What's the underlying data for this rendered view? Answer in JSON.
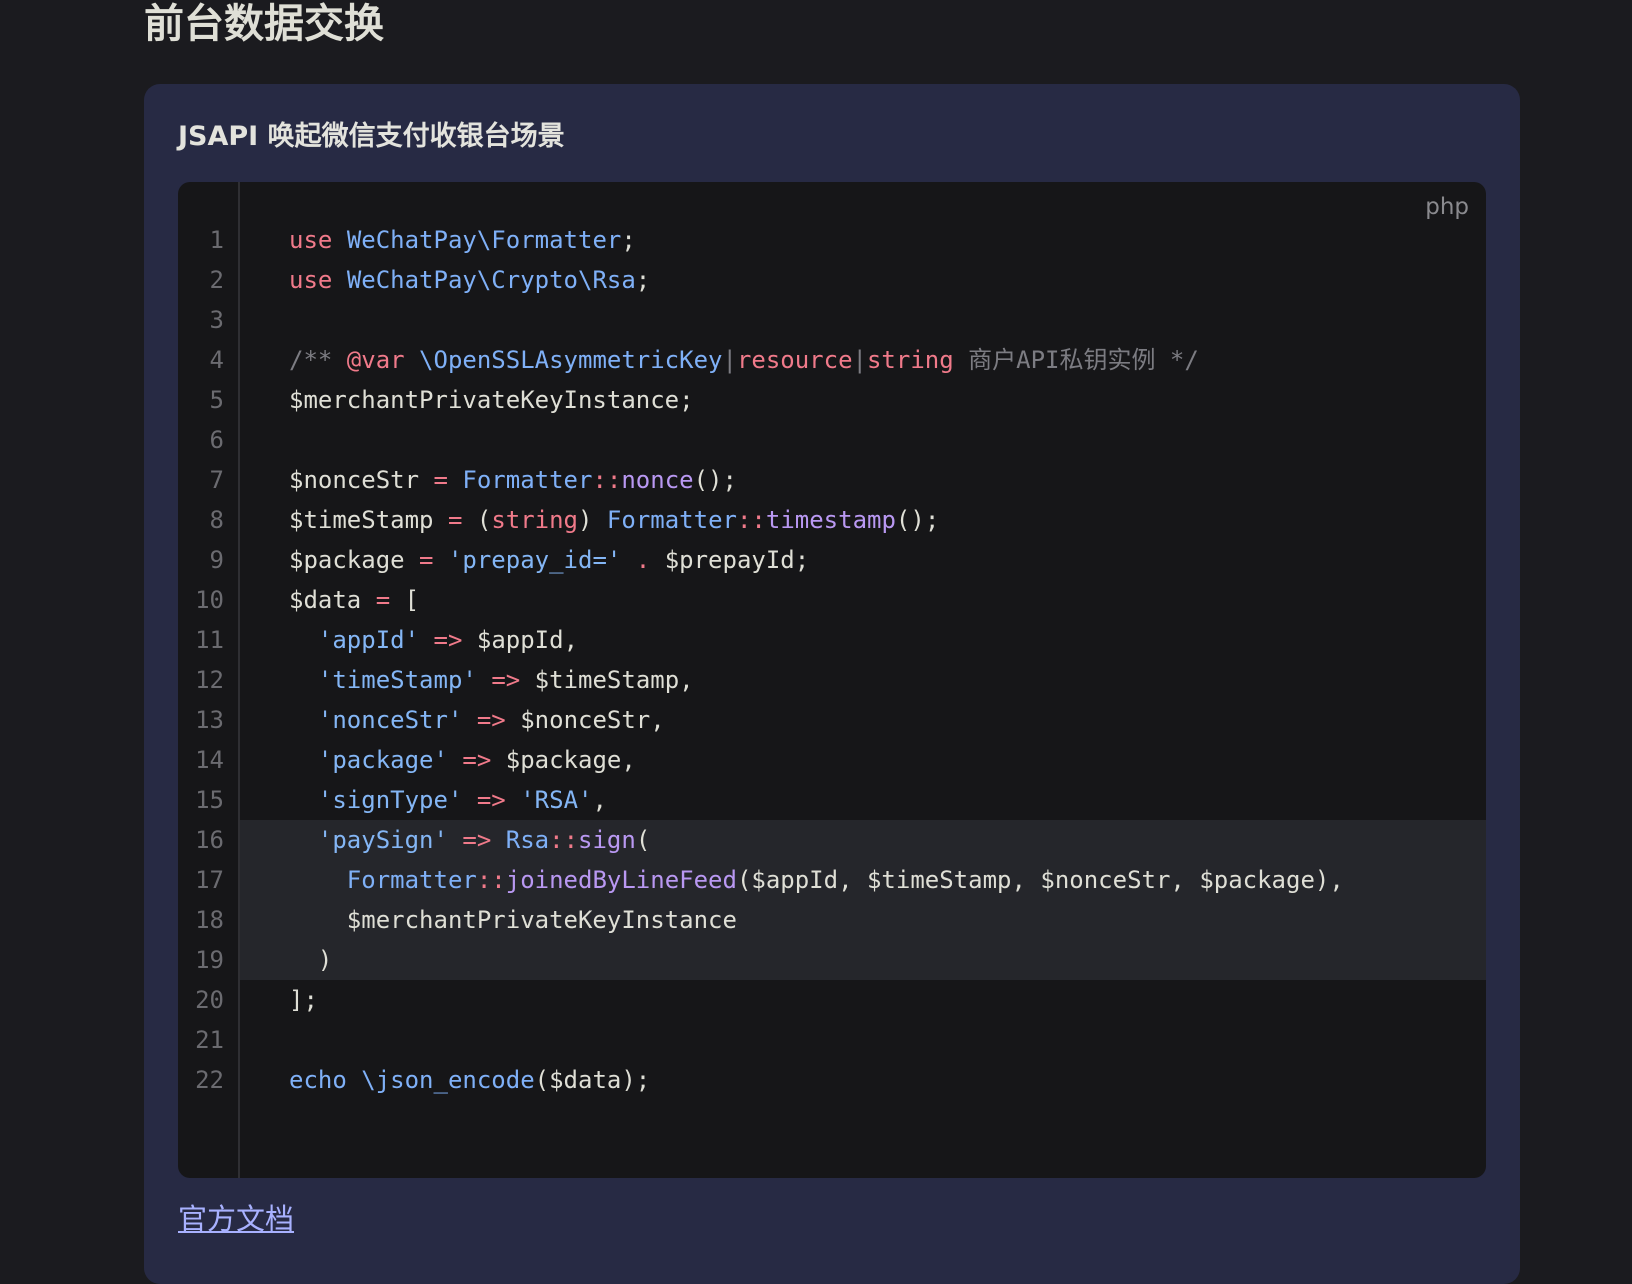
{
  "page": {
    "title": "前台数据交换"
  },
  "card": {
    "title": "JSAPI 唤起微信支付收银台场景",
    "lang_label": "php",
    "doc_link": "官方文档"
  },
  "code": {
    "highlighted_lines": [
      16,
      17,
      18,
      19
    ],
    "lines": [
      [
        [
          "kw",
          "use"
        ],
        [
          "t",
          " "
        ],
        [
          "ns",
          "WeChatPay\\Formatter"
        ],
        [
          "t",
          ";"
        ]
      ],
      [
        [
          "kw",
          "use"
        ],
        [
          "t",
          " "
        ],
        [
          "ns",
          "WeChatPay\\Crypto\\Rsa"
        ],
        [
          "t",
          ";"
        ]
      ],
      [],
      [
        [
          "cm",
          "/** "
        ],
        [
          "tag",
          "@var"
        ],
        [
          "t",
          " "
        ],
        [
          "ns",
          "\\OpenSSLAsymmetricKey"
        ],
        [
          "cm",
          "|"
        ],
        [
          "kw",
          "resource"
        ],
        [
          "cm",
          "|"
        ],
        [
          "kw",
          "string"
        ],
        [
          "cm",
          " 商户API私钥实例 */"
        ]
      ],
      [
        [
          "t",
          "$merchantPrivateKeyInstance;"
        ]
      ],
      [],
      [
        [
          "t",
          "$nonceStr "
        ],
        [
          "op",
          "="
        ],
        [
          "t",
          " "
        ],
        [
          "ns",
          "Formatter"
        ],
        [
          "op",
          "::"
        ],
        [
          "fn",
          "nonce"
        ],
        [
          "t",
          "();"
        ]
      ],
      [
        [
          "t",
          "$timeStamp "
        ],
        [
          "op",
          "="
        ],
        [
          "t",
          " ("
        ],
        [
          "kw",
          "string"
        ],
        [
          "t",
          ") "
        ],
        [
          "ns",
          "Formatter"
        ],
        [
          "op",
          "::"
        ],
        [
          "fn",
          "timestamp"
        ],
        [
          "t",
          "();"
        ]
      ],
      [
        [
          "t",
          "$package "
        ],
        [
          "op",
          "="
        ],
        [
          "t",
          " "
        ],
        [
          "str",
          "'prepay_id='"
        ],
        [
          "t",
          " "
        ],
        [
          "op",
          "."
        ],
        [
          "t",
          " $prepayId;"
        ]
      ],
      [
        [
          "t",
          "$data "
        ],
        [
          "op",
          "="
        ],
        [
          "t",
          " ["
        ]
      ],
      [
        [
          "t",
          "  "
        ],
        [
          "str",
          "'appId'"
        ],
        [
          "t",
          " "
        ],
        [
          "op",
          "=>"
        ],
        [
          "t",
          " $appId,"
        ]
      ],
      [
        [
          "t",
          "  "
        ],
        [
          "str",
          "'timeStamp'"
        ],
        [
          "t",
          " "
        ],
        [
          "op",
          "=>"
        ],
        [
          "t",
          " $timeStamp,"
        ]
      ],
      [
        [
          "t",
          "  "
        ],
        [
          "str",
          "'nonceStr'"
        ],
        [
          "t",
          " "
        ],
        [
          "op",
          "=>"
        ],
        [
          "t",
          " $nonceStr,"
        ]
      ],
      [
        [
          "t",
          "  "
        ],
        [
          "str",
          "'package'"
        ],
        [
          "t",
          " "
        ],
        [
          "op",
          "=>"
        ],
        [
          "t",
          " $package,"
        ]
      ],
      [
        [
          "t",
          "  "
        ],
        [
          "str",
          "'signType'"
        ],
        [
          "t",
          " "
        ],
        [
          "op",
          "=>"
        ],
        [
          "t",
          " "
        ],
        [
          "str",
          "'RSA'"
        ],
        [
          "t",
          ","
        ]
      ],
      [
        [
          "t",
          "  "
        ],
        [
          "str",
          "'paySign'"
        ],
        [
          "t",
          " "
        ],
        [
          "op",
          "=>"
        ],
        [
          "t",
          " "
        ],
        [
          "ns",
          "Rsa"
        ],
        [
          "op",
          "::"
        ],
        [
          "fn",
          "sign"
        ],
        [
          "t",
          "("
        ]
      ],
      [
        [
          "t",
          "    "
        ],
        [
          "ns",
          "Formatter"
        ],
        [
          "op",
          "::"
        ],
        [
          "fn",
          "joinedByLineFeed"
        ],
        [
          "t",
          "($appId, $timeStamp, $nonceStr, $package),"
        ]
      ],
      [
        [
          "t",
          "    $merchantPrivateKeyInstance"
        ]
      ],
      [
        [
          "t",
          "  )"
        ]
      ],
      [
        [
          "t",
          "];"
        ]
      ],
      [],
      [
        [
          "ns",
          "echo"
        ],
        [
          "t",
          " "
        ],
        [
          "ns",
          "\\json_encode"
        ],
        [
          "t",
          "($data);"
        ]
      ]
    ]
  },
  "colors": {
    "background": "#1b1b1f",
    "card": "#272a44",
    "code_bg": "#161618",
    "keyword": "#f07a8a",
    "namespace": "#7fb0f7",
    "function": "#b998f2",
    "comment": "#7c7c82",
    "link": "#a8b1ff"
  }
}
